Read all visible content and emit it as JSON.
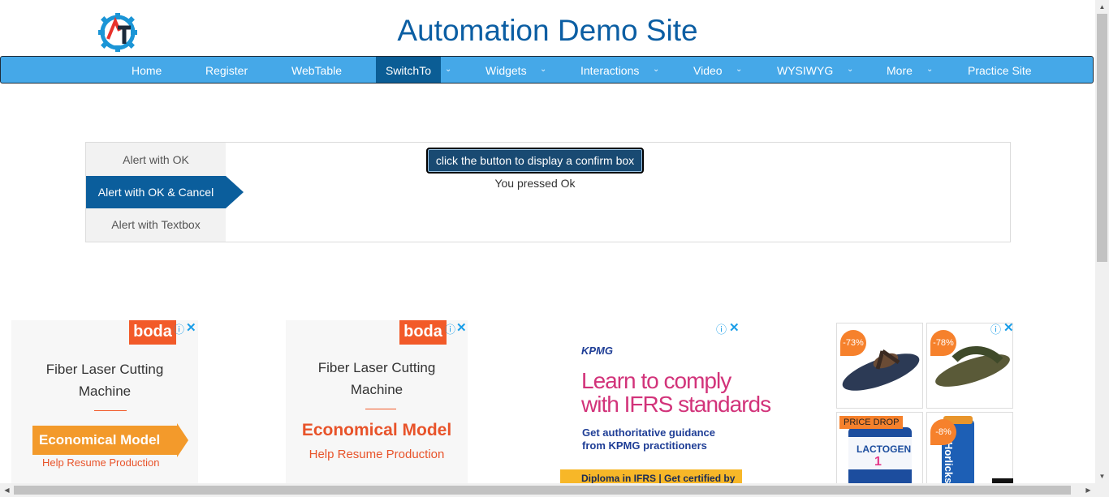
{
  "header": {
    "title": "Automation Demo Site"
  },
  "nav": {
    "items": [
      {
        "label": "Home"
      },
      {
        "label": "Register"
      },
      {
        "label": "WebTable"
      },
      {
        "label": "SwitchTo"
      },
      {
        "label": "Widgets"
      },
      {
        "label": "Interactions"
      },
      {
        "label": "Video"
      },
      {
        "label": "WYSIWYG"
      },
      {
        "label": "More"
      },
      {
        "label": "Practice Site"
      }
    ],
    "active": "SwitchTo",
    "caret": "⌄"
  },
  "tabs": [
    {
      "label": "Alert with OK"
    },
    {
      "label": "Alert with OK & Cancel"
    },
    {
      "label": "Alert with Textbox"
    }
  ],
  "content": {
    "button_label": "click the button to display a confirm box",
    "result": "You pressed Ok"
  },
  "ads": {
    "boda1": {
      "logo": "boda",
      "line1": "Fiber Laser Cutting",
      "line2": "Machine",
      "cta": "Economical Model",
      "sub": "Help Resume Production"
    },
    "boda2": {
      "logo": "boda",
      "line1": "Fiber Laser Cutting",
      "line2": "Machine",
      "cta": "Economical Model",
      "sub": "Help Resume Production"
    },
    "kpmg": {
      "logo": "KPMG",
      "head1": "Learn to comply",
      "head2": "with IFRS standards",
      "sub1": "Get authoritative guidance",
      "sub2": "from KPMG practitioners",
      "band": "Diploma in IFRS | Get certified by"
    },
    "shop": {
      "tags": [
        "-73%",
        "-78%",
        "PRICE DROP",
        "-8%"
      ],
      "product1": "LACTOGEN",
      "product1_num": "1",
      "product2": "Horlicks"
    },
    "info_icon": "ⓘ",
    "close_icon": "✕"
  },
  "colors": {
    "nav_bg": "#45a8e8",
    "nav_active": "#0b5d95",
    "title": "#0b5ea3",
    "accent_orange": "#f25a29"
  }
}
